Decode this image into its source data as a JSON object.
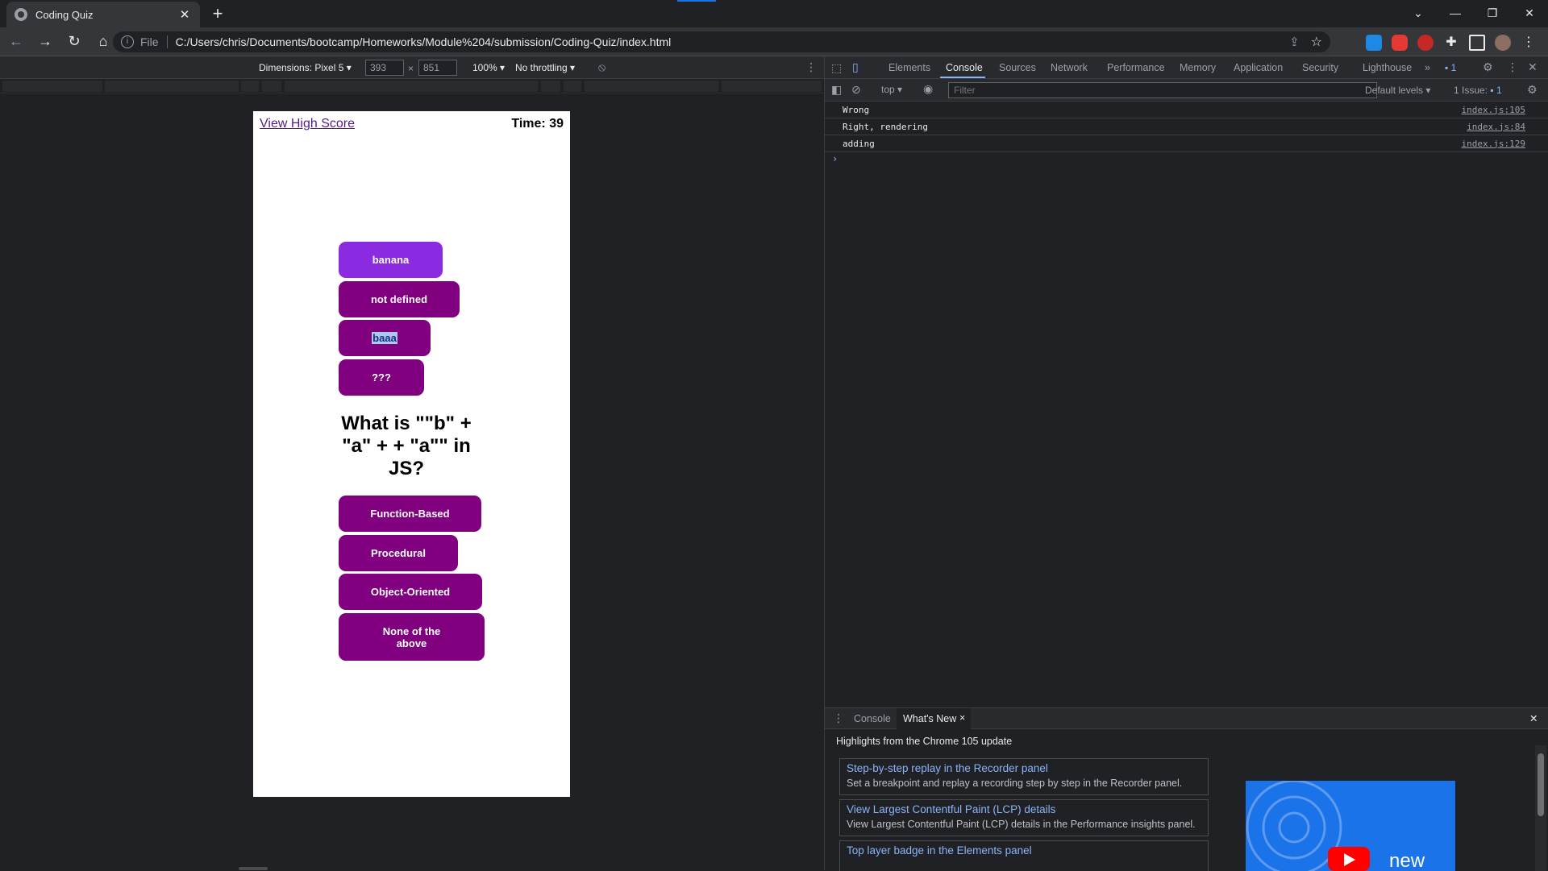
{
  "browser": {
    "tab_title": "Coding Quiz",
    "new_tab": "+",
    "scheme": "File",
    "url": "C:/Users/chris/Documents/bootcamp/Homeworks/Module%204/submission/Coding-Quiz/index.html"
  },
  "device_toolbar": {
    "dimensions_label": "Dimensions: Pixel 5",
    "width": "393",
    "height": "851",
    "times": "×",
    "zoom": "100%",
    "throttling": "No throttling"
  },
  "page": {
    "high_score_link": "View High Score",
    "timer": "Time: 39",
    "answers_top": [
      "banana",
      "not defined",
      "baaa",
      "???"
    ],
    "question": "What is \"\"b\" + \"a\" + + \"a\"\" in JS?",
    "answers_bottom": [
      "Function-Based",
      "Procedural",
      "Object-Oriented",
      "None of the above"
    ]
  },
  "devtools": {
    "tabs": [
      "Elements",
      "Console",
      "Sources",
      "Network",
      "Performance",
      "Memory",
      "Application",
      "Security",
      "Lighthouse"
    ],
    "active_tab": "Console",
    "more_tabs": "»",
    "issue_badge_count": "1",
    "context": "top",
    "filter_placeholder": "Filter",
    "levels": "Default levels",
    "issues_summary": "1 Issue:",
    "issues_count": "1",
    "logs": [
      {
        "message": "Wrong",
        "source": "index.js:105"
      },
      {
        "message": "Right, rendering",
        "source": "index.js:84"
      },
      {
        "message": "adding",
        "source": "index.js:129"
      }
    ],
    "prompt": "›"
  },
  "drawer": {
    "tabs": [
      "Console",
      "What's New"
    ],
    "close_tab": "×",
    "highlights": "Highlights from the Chrome 105 update",
    "cards": [
      {
        "title": "Step-by-step replay in the Recorder panel",
        "desc": "Set a breakpoint and replay a recording step by step in the Recorder panel."
      },
      {
        "title": "View Largest Contentful Paint (LCP) details",
        "desc": "View Largest Contentful Paint (LCP) details in the Performance insights panel."
      },
      {
        "title": "Top layer badge in the Elements panel",
        "desc": ""
      }
    ],
    "video_text": "new"
  },
  "colors": {
    "answer_button": "#800080",
    "answer_button_hover": "#8a2be2",
    "devtools_accent": "#8ab4f8"
  }
}
